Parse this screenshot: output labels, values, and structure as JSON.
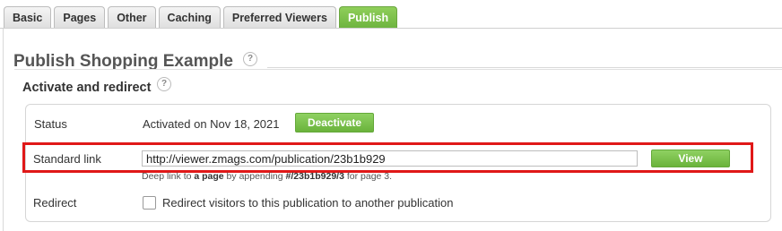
{
  "tabs": [
    {
      "label": "Basic"
    },
    {
      "label": "Pages"
    },
    {
      "label": "Other"
    },
    {
      "label": "Caching"
    },
    {
      "label": "Preferred Viewers"
    },
    {
      "label": "Publish",
      "active": true
    }
  ],
  "page": {
    "title": "Publish Shopping Example",
    "help_glyph": "?"
  },
  "section": {
    "title": "Activate and redirect",
    "help_glyph": "?"
  },
  "status": {
    "label": "Status",
    "text": "Activated on Nov 18, 2021",
    "button_label": "Deactivate"
  },
  "standard_link": {
    "label": "Standard link",
    "value": "http://viewer.zmags.com/publication/23b1b929",
    "button_label": "View",
    "hint_prefix": "Deep link to ",
    "hint_bold1": "a page",
    "hint_mid": " by appending ",
    "hint_bold2": "#/23b1b929/3",
    "hint_suffix": " for page 3."
  },
  "redirect": {
    "label": "Redirect",
    "checkbox_text": "Redirect visitors to this publication to another publication",
    "checked": false
  },
  "colors": {
    "accent": "#6ab33b",
    "highlight": "#e01818"
  }
}
